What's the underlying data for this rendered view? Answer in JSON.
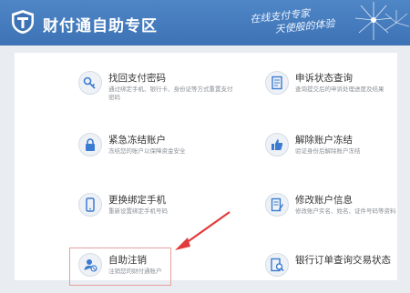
{
  "header": {
    "title": "财付通自助专区",
    "slogan_line1": "在线支付专家",
    "slogan_line2": "天使般的体验"
  },
  "cards": [
    {
      "title": "找回支付密码",
      "desc1": "通过绑定手机、银行卡、身份证等方式重置支付",
      "desc2": "密码",
      "icon": "key-icon"
    },
    {
      "title": "申诉状态查询",
      "desc1": "查询提交后的申诉处理进度及结果",
      "desc2": "",
      "icon": "document-icon"
    },
    {
      "title": "紧急冻结账户",
      "desc1": "冻结您的账户以保障资金安全",
      "desc2": "",
      "icon": "lock-icon"
    },
    {
      "title": "解除账户冻结",
      "desc1": "验证身份后解除账户冻结",
      "desc2": "",
      "icon": "thumbs-up-icon"
    },
    {
      "title": "更换绑定手机",
      "desc1": "重新设置绑定手机号码",
      "desc2": "",
      "icon": "phone-icon"
    },
    {
      "title": "修改账户信息",
      "desc1": "修改账户实名、姓名、证件号码等资料",
      "desc2": "",
      "icon": "document-edit-icon"
    },
    {
      "title": "自助注销",
      "desc1": "注销您的财付通账户",
      "desc2": "",
      "icon": "user-cancel-icon"
    },
    {
      "title": "银行订单查询交易状态",
      "desc1": "",
      "desc2": "",
      "icon": "search-document-icon"
    }
  ],
  "colors": {
    "header": "#3d73b5",
    "accent": "#3b7bd0",
    "arrow": "#e23b3b",
    "highlight": "#e7a0a0"
  }
}
